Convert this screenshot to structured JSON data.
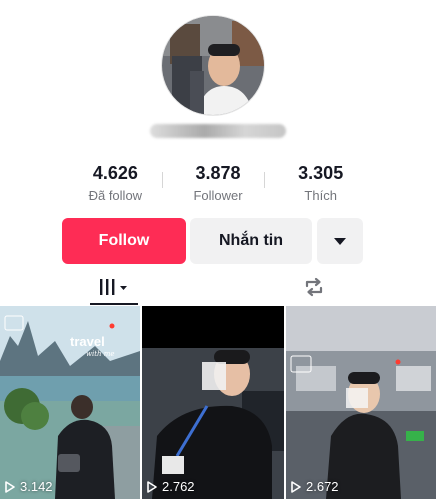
{
  "profile": {
    "avatar_icon": "profile-photo",
    "username": ""
  },
  "stats": [
    {
      "value": "4.626",
      "label": "Đã follow"
    },
    {
      "value": "3.878",
      "label": "Follower"
    },
    {
      "value": "3.305",
      "label": "Thích"
    }
  ],
  "actions": {
    "follow_label": "Follow",
    "message_label": "Nhắn tin",
    "more_icon": "caret-down-icon"
  },
  "tabs": {
    "videos_icon": "video-grid-icon",
    "repost_icon": "repost-icon"
  },
  "videos": [
    {
      "views": "3.142",
      "caption": "travel with me"
    },
    {
      "views": "2.762"
    },
    {
      "views": "2.672"
    }
  ],
  "colors": {
    "accent": "#fe2c55",
    "button_gray": "#f1f1f2",
    "text_primary": "#161823",
    "text_secondary": "#73757b"
  }
}
